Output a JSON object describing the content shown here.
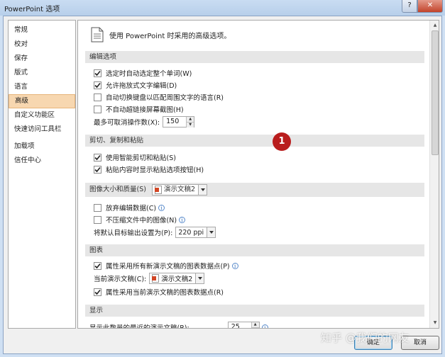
{
  "window": {
    "title": "PowerPoint 选项",
    "help_label": "?",
    "close_label": "✕"
  },
  "nav": {
    "items": [
      {
        "label": "常规"
      },
      {
        "label": "校对"
      },
      {
        "label": "保存"
      },
      {
        "label": "版式"
      },
      {
        "label": "语言"
      },
      {
        "label": "高级",
        "selected": true
      },
      {
        "label": "自定义功能区"
      },
      {
        "label": "快速访问工具栏"
      },
      {
        "label": "加载项"
      },
      {
        "label": "信任中心"
      }
    ]
  },
  "intro": {
    "text": "使用 PowerPoint 时采用的高级选项。"
  },
  "editing": {
    "header": "编辑选项",
    "options": [
      {
        "label": "选定时自动选定整个单词(W)",
        "checked": true
      },
      {
        "label": "允许拖放式文字编辑(D)",
        "checked": true
      },
      {
        "label": "自动切换键盘以匹配周围文字的语言(R)",
        "checked": false
      },
      {
        "label": "不自动超链接屏幕截图(H)",
        "checked": false
      }
    ],
    "undo_label": "最多可取消操作数(X):",
    "undo_value": "150"
  },
  "clipboard": {
    "header": "剪切、复制和粘贴",
    "options": [
      {
        "label": "使用智能剪切和粘贴(S)",
        "checked": true
      },
      {
        "label": "粘贴内容时显示粘贴选项按钮(H)",
        "checked": true
      }
    ]
  },
  "image": {
    "header": "图像大小和质量(S)",
    "doc_selected": "演示文稿2",
    "options": [
      {
        "label": "放弃编辑数据(C)",
        "checked": false
      },
      {
        "label": "不压缩文件中的图像(N)",
        "checked": false
      }
    ],
    "resolution_label": "将默认目标输出设置为(P):",
    "resolution_value": "220 ppi"
  },
  "chart": {
    "header": "图表",
    "option_all": {
      "label": "属性采用所有新演示文稿的图表数据点(P)",
      "checked": true
    },
    "current_label": "当前演示文稿(C):",
    "current_value": "演示文稿2",
    "option_current": {
      "label": "属性采用当前演示文稿的图表数据点(R)",
      "checked": true
    }
  },
  "display": {
    "header": "显示",
    "recent_label": "显示此数量的最近的演示文稿(R):",
    "recent_value": "25"
  },
  "callout": {
    "number": "1"
  },
  "buttons": {
    "ok": "确定",
    "cancel": "取消"
  },
  "watermark": "知乎 @我们的网友",
  "colors": {
    "selected_nav": "#f7d7b0",
    "callout": "#b91d1d"
  }
}
